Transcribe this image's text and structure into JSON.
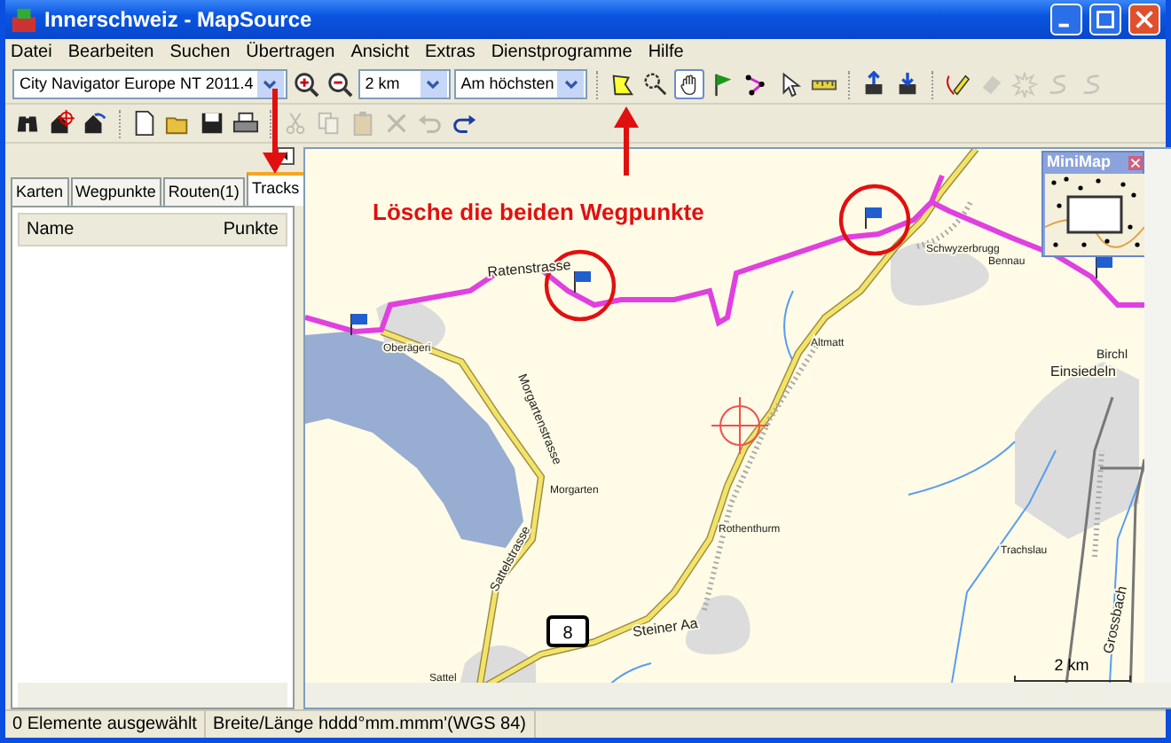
{
  "window": {
    "title": "Innerschweiz - MapSource"
  },
  "menu": [
    "Datei",
    "Bearbeiten",
    "Suchen",
    "Übertragen",
    "Ansicht",
    "Extras",
    "Dienstprogramme",
    "Hilfe"
  ],
  "toolbar_1": {
    "map_product": "City Navigator Europe NT 2011.4",
    "zoom_scale": "2 km",
    "detail": "Am höchsten",
    "tools": [
      {
        "kind": "zoomin",
        "selected": false,
        "disabled": false
      },
      {
        "kind": "zoomout",
        "selected": false,
        "disabled": false
      },
      {
        "kind": "dropdowns"
      },
      {
        "kind": "area",
        "selected": false,
        "disabled": false
      },
      {
        "kind": "magnify",
        "selected": false,
        "disabled": false
      },
      {
        "kind": "hand",
        "selected": true,
        "disabled": false
      },
      {
        "kind": "waypoint",
        "selected": false,
        "disabled": false
      },
      {
        "kind": "route",
        "selected": false,
        "disabled": false
      },
      {
        "kind": "select",
        "selected": false,
        "disabled": false
      },
      {
        "kind": "measure",
        "selected": false,
        "disabled": false
      },
      {
        "kind": "separator"
      },
      {
        "kind": "send",
        "selected": false,
        "disabled": false
      },
      {
        "kind": "receive",
        "selected": false,
        "disabled": false
      },
      {
        "kind": "separator"
      },
      {
        "kind": "pencil",
        "selected": false,
        "disabled": false
      },
      {
        "kind": "eraser",
        "selected": false,
        "disabled": true
      },
      {
        "kind": "burst",
        "selected": false,
        "disabled": true
      },
      {
        "kind": "squiggle",
        "selected": false,
        "disabled": true
      },
      {
        "kind": "squiggle",
        "selected": false,
        "disabled": true
      }
    ]
  },
  "toolbar_2": {
    "tools": [
      {
        "kind": "binoculars",
        "disabled": false
      },
      {
        "kind": "findplace",
        "disabled": false
      },
      {
        "kind": "findnear",
        "disabled": false
      },
      {
        "kind": "separator"
      },
      {
        "kind": "new",
        "disabled": false
      },
      {
        "kind": "open",
        "disabled": false
      },
      {
        "kind": "save",
        "disabled": false
      },
      {
        "kind": "print",
        "disabled": false
      },
      {
        "kind": "separator"
      },
      {
        "kind": "cut",
        "disabled": true
      },
      {
        "kind": "copy",
        "disabled": true
      },
      {
        "kind": "paste",
        "disabled": true
      },
      {
        "kind": "delete",
        "disabled": true
      },
      {
        "kind": "undo",
        "disabled": true
      },
      {
        "kind": "redo",
        "disabled": false
      }
    ]
  },
  "sidebar": {
    "tabs": [
      {
        "label": "Karten",
        "selected": false
      },
      {
        "label": "Wegpunkte",
        "selected": false
      },
      {
        "label": "Routen(1)",
        "selected": false
      },
      {
        "label": "Tracks",
        "selected": true
      }
    ],
    "columns": [
      "Name",
      "Punkte"
    ]
  },
  "map": {
    "instruction": "Lösche die beiden Wegpunkte",
    "minimap_title": "MiniMap",
    "road_number": "8",
    "scale": "2 km",
    "places": [
      "Ratenstrasse",
      "Oberägeri",
      "Morgartenstrasse",
      "Morgarten",
      "Sattelstrasse",
      "Sattel",
      "Steiner Aa",
      "Rothenthurm",
      "Altmatt",
      "Schwyzerbrugg",
      "Bennau",
      "Einsiedeln",
      "Birchl",
      "Trachslau",
      "Grossbach"
    ]
  },
  "status_bar": [
    "0 Elemente ausgewählt",
    "Breite/Länge hddd°mm.mmm'(WGS 84)"
  ]
}
